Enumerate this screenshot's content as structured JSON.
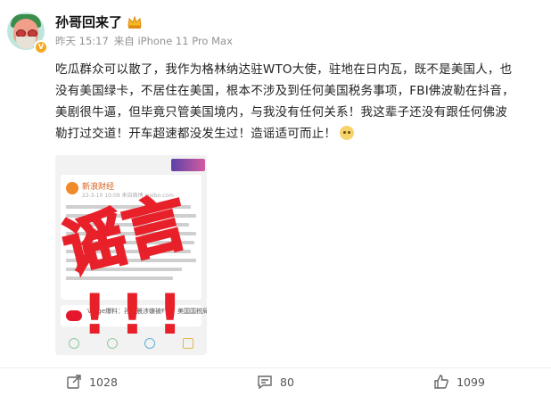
{
  "post": {
    "username": "孙哥回来了",
    "time": "昨天 15:17",
    "source": "来自 iPhone 11 Pro Max",
    "content": "吃瓜群众可以散了，我作为格林纳达驻WTO大使，驻地在日内瓦，既不是美国人，也没有美国绿卡，不居住在美国，根本不涉及到任何美国税务事项，FBI佛波勒在抖音，美剧很牛逼，但毕竟只管美国境内，与我没有任何关系！我这辈子还没有跟任何佛波勒打过交道！开车超速都没发生过！造谣适可而止！",
    "emoji_icon": "doge-emoji-icon"
  },
  "embedded_image": {
    "source_name": "新浪财经",
    "date": "22-3-10 10:09 来自微博 weibo.com",
    "news_text": "Verge爆料：孙宇晨涉嫌被FBI、美国国税局调查",
    "stamp_text": "谣言",
    "stamp_marks": "!!!",
    "colors": {
      "stamp": "#e8202a",
      "weibo": "#e6162d"
    }
  },
  "footer": {
    "repost_count": "1028",
    "comment_count": "80",
    "like_count": "1099",
    "repost_icon": "share-icon",
    "comment_icon": "comment-icon",
    "like_icon": "thumbs-up-icon"
  }
}
